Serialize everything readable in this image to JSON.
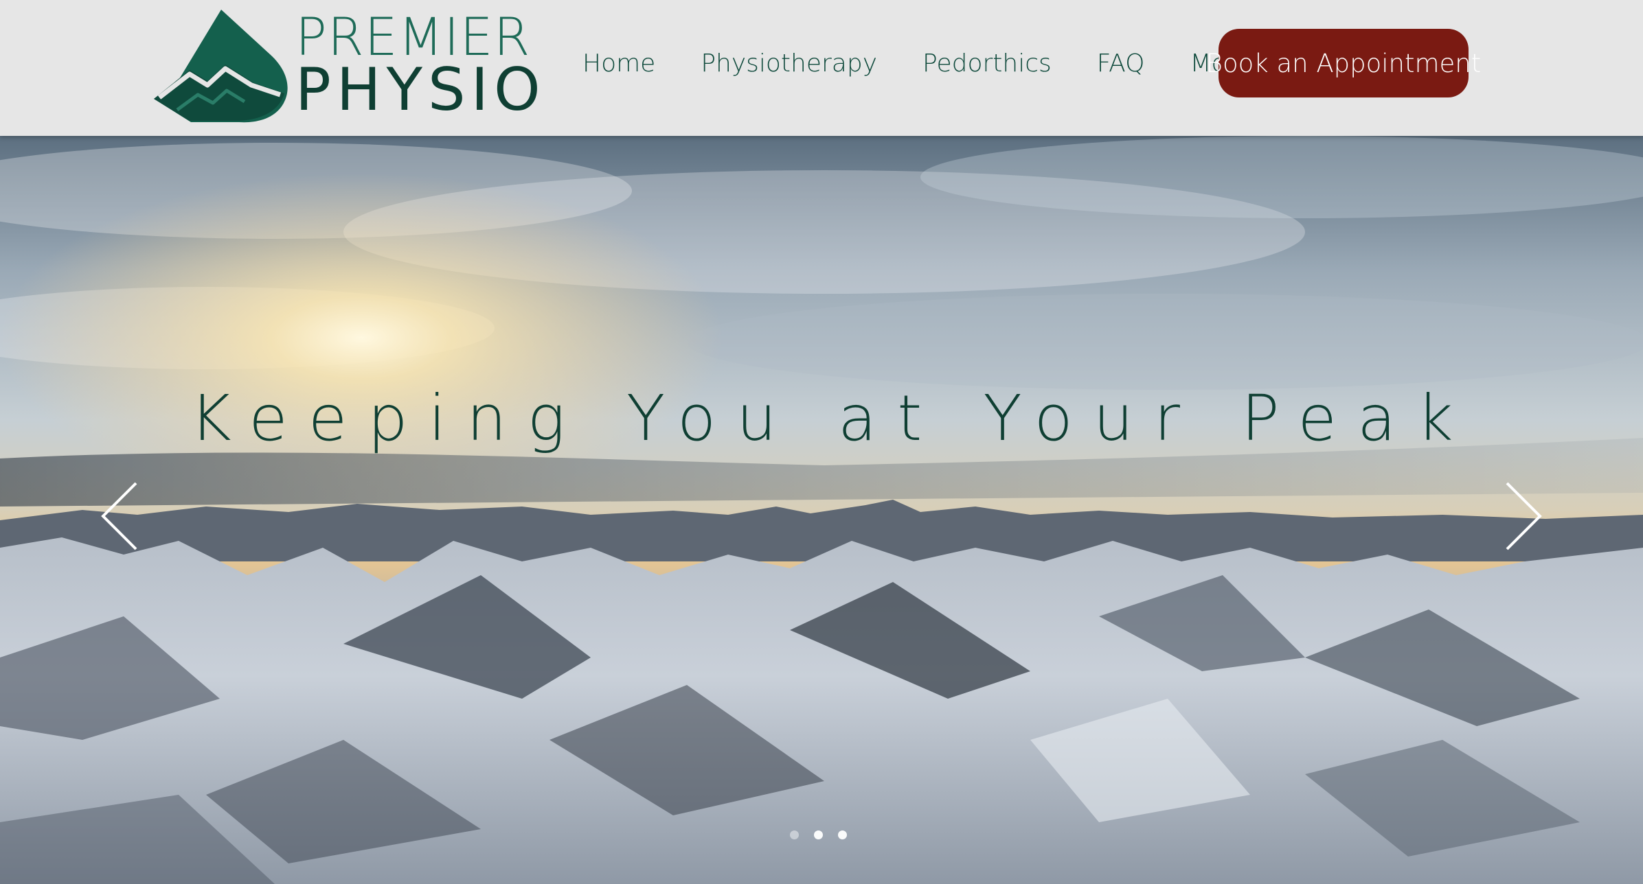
{
  "brand": {
    "name_line1": "PREMIER",
    "name_line2": "PHYSIO",
    "logo_icon": "mountain-droplet-logo",
    "primary_color": "#0f4a3c",
    "accent_color": "#7a1a12"
  },
  "nav": {
    "items": [
      {
        "label": "Home"
      },
      {
        "label": "Physiotherapy"
      },
      {
        "label": "Pedorthics"
      },
      {
        "label": "FAQ"
      },
      {
        "label": "More"
      }
    ],
    "cta_label": "Book an Appointment"
  },
  "hero": {
    "title": "Keeping You at Your Peak",
    "prev_icon": "chevron-left-icon",
    "next_icon": "chevron-right-icon",
    "slides_count": 3,
    "active_slide": 2
  }
}
